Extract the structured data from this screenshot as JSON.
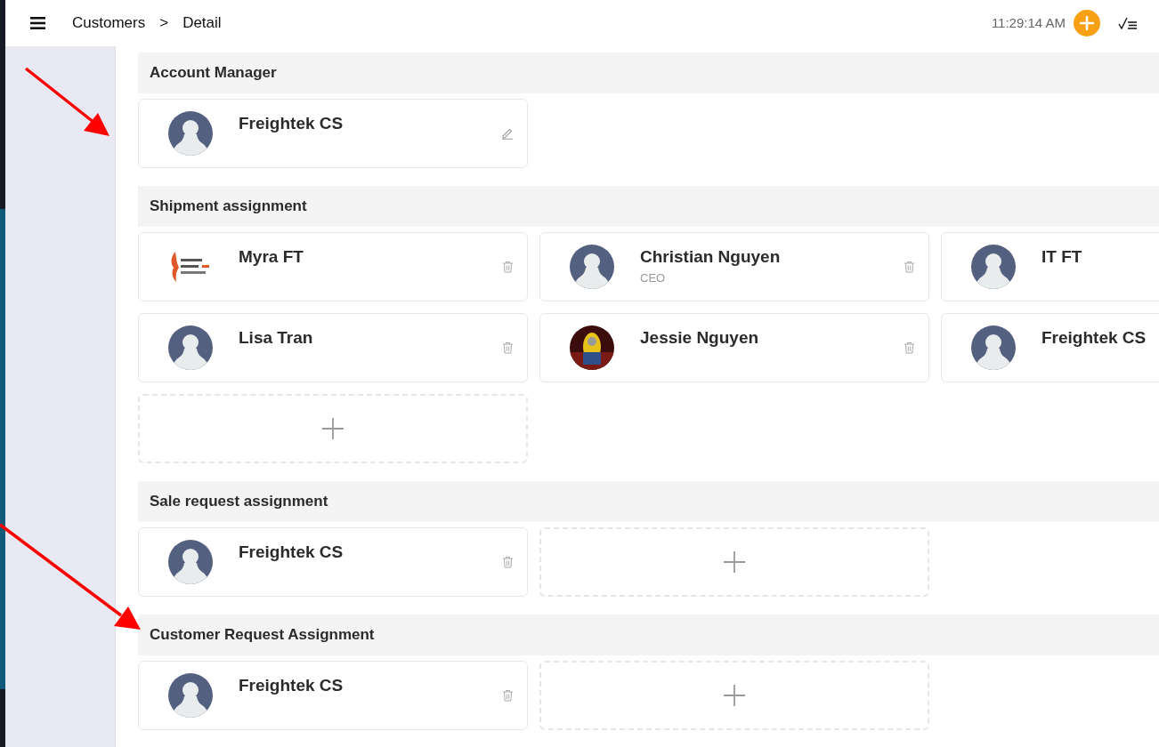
{
  "breadcrumb": [
    "Customers",
    ">",
    "Detail"
  ],
  "clock": "11:29:14 AM",
  "sections": [
    {
      "title": "Account Manager",
      "add_card": false,
      "members": [
        {
          "name": "Freightek CS",
          "kind": "default",
          "edit_icon": true,
          "delete_icon": false
        }
      ]
    },
    {
      "title": "Shipment assignment",
      "add_card": true,
      "members": [
        {
          "name": "Myra FT",
          "kind": "logo",
          "edit_icon": false,
          "delete_icon": true
        },
        {
          "name": "Christian Nguyen",
          "subtitle": "CEO",
          "kind": "default",
          "edit_icon": false,
          "delete_icon": true
        },
        {
          "name": "IT FT",
          "kind": "default",
          "edit_icon": false,
          "delete_icon": false
        },
        {
          "name": "Lisa Tran",
          "kind": "default",
          "edit_icon": false,
          "delete_icon": true
        },
        {
          "name": "Jessie Nguyen",
          "edit_icon": false,
          "delete_icon": true
        },
        {
          "name": "Freightek CS",
          "kind": "default",
          "edit_icon": false,
          "delete_icon": false
        }
      ]
    },
    {
      "title": "Sale request assignment",
      "add_card": true,
      "members": [
        {
          "name": "Freightek CS",
          "kind": "default",
          "edit_icon": false,
          "delete_icon": true
        }
      ]
    },
    {
      "title": "Customer Request Assignment",
      "add_card": true,
      "members": [
        {
          "name": "Freightek CS",
          "kind": "default",
          "edit_icon": false,
          "delete_icon": true
        }
      ]
    }
  ]
}
